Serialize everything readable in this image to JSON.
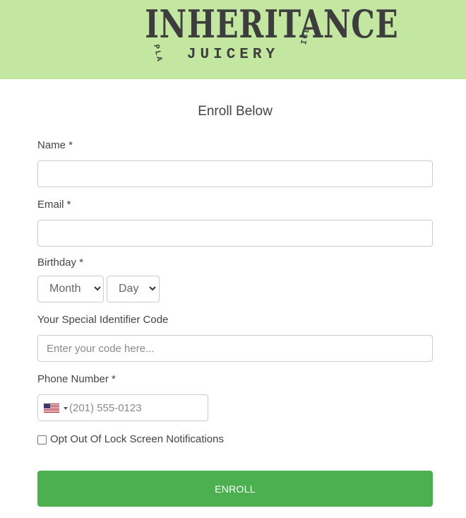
{
  "header": {
    "logo_main": "INHERITANCE",
    "logo_sub": "JUICERY",
    "logo_arc_left": "PLA",
    "logo_arc_right": "ICE",
    "background_color": "#c3e6a1"
  },
  "form": {
    "title": "Enroll Below",
    "name": {
      "label": "Name *",
      "value": ""
    },
    "email": {
      "label": "Email *",
      "value": ""
    },
    "birthday": {
      "label": "Birthday *",
      "month_selected": "Month",
      "day_selected": "Day"
    },
    "code": {
      "label": "Your Special Identifier Code",
      "placeholder": "Enter your code here...",
      "value": ""
    },
    "phone": {
      "label": "Phone Number *",
      "placeholder": "(201) 555-0123",
      "country_flag": "us-flag-icon",
      "value": ""
    },
    "opt_out": {
      "label": "Opt Out Of Lock Screen Notifications",
      "checked": false
    },
    "submit_label": "ENROLL",
    "accent_color": "#4caf50"
  }
}
